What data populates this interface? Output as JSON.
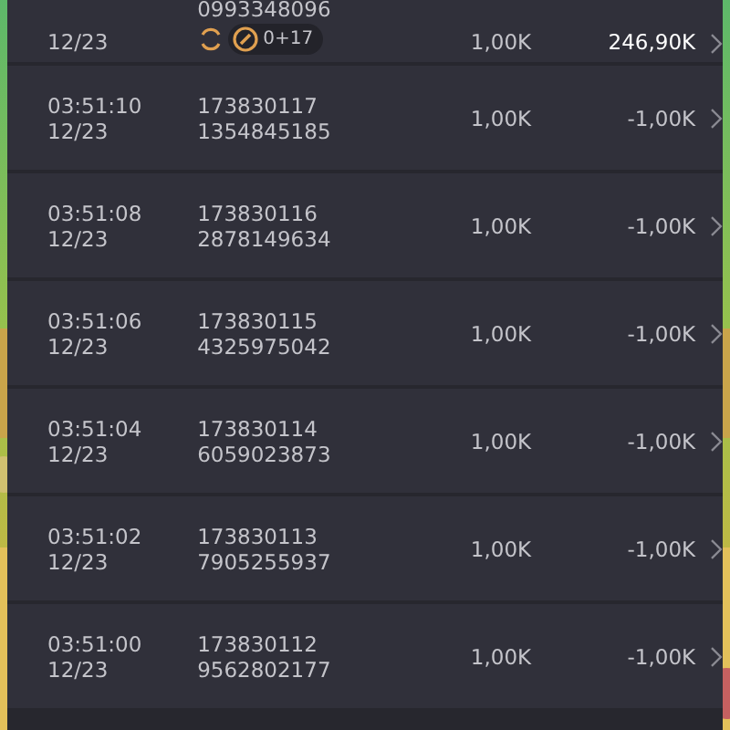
{
  "rows": [
    {
      "time": "",
      "date": "12/23",
      "id": "0993348096",
      "ref": "",
      "amount": "1,00K",
      "result": "246,90K",
      "highlight": true,
      "bonus": {
        "count": "0+17"
      }
    },
    {
      "time": "03:51:10",
      "date": "12/23",
      "id": "173830117",
      "ref": "1354845185",
      "amount": "1,00K",
      "result": "-1,00K",
      "highlight": false
    },
    {
      "time": "03:51:08",
      "date": "12/23",
      "id": "173830116",
      "ref": "2878149634",
      "amount": "1,00K",
      "result": "-1,00K",
      "highlight": false
    },
    {
      "time": "03:51:06",
      "date": "12/23",
      "id": "173830115",
      "ref": "4325975042",
      "amount": "1,00K",
      "result": "-1,00K",
      "highlight": false
    },
    {
      "time": "03:51:04",
      "date": "12/23",
      "id": "173830114",
      "ref": "6059023873",
      "amount": "1,00K",
      "result": "-1,00K",
      "highlight": false
    },
    {
      "time": "03:51:02",
      "date": "12/23",
      "id": "173830113",
      "ref": "7905255937",
      "amount": "1,00K",
      "result": "-1,00K",
      "highlight": false
    },
    {
      "time": "03:51:00",
      "date": "12/23",
      "id": "173830112",
      "ref": "9562802177",
      "amount": "1,00K",
      "result": "-1,00K",
      "highlight": false
    }
  ]
}
